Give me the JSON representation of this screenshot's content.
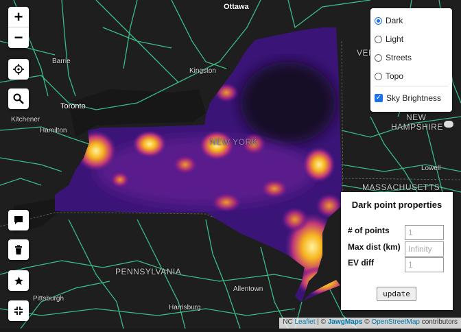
{
  "cities": {
    "ottawa": "Ottawa",
    "barrie": "Barrie",
    "kingston": "Kingston",
    "toronto": "Toronto",
    "kitchener": "Kitchener",
    "hamilton": "Hamilton",
    "lowell": "Lowell",
    "pittsburgh": "Pittsburgh",
    "harrisburg": "Harrisburg",
    "allentown": "Allentown",
    "new_york": "NEW YORK"
  },
  "regions": {
    "ver": "VER",
    "new_hampshire_1": "NEW",
    "new_hampshire_2": "HAMPSHIRE",
    "massachusetts": "MASSACHUSETTS",
    "pennsylvania": "PENNSYLVANIA"
  },
  "zoom": {
    "in": "+",
    "out": "−"
  },
  "icons": [
    "locate-icon",
    "search-icon",
    "comment-icon",
    "trash-icon",
    "star-icon",
    "collapse-icon"
  ],
  "layers": {
    "base": [
      {
        "label": "Dark",
        "selected": true
      },
      {
        "label": "Light",
        "selected": false
      },
      {
        "label": "Streets",
        "selected": false
      },
      {
        "label": "Topo",
        "selected": false
      }
    ],
    "overlay": {
      "label": "Sky Brightness",
      "checked": true
    }
  },
  "panel": {
    "title": "Dark point properties",
    "fields": [
      {
        "label": "# of points",
        "placeholder": "1"
      },
      {
        "label": "Max dist (km)",
        "placeholder": "Infinity"
      },
      {
        "label": "EV diff",
        "placeholder": "1"
      }
    ],
    "button": "update"
  },
  "attribution": {
    "prefix": "NC",
    "leaflet": "Leaflet",
    "sep1": " | © ",
    "jawg": "JawgMaps",
    "sep2": " © ",
    "osm": "OpenStreetMap",
    "suffix": " contributors"
  },
  "colors": {
    "map_bg": "#1e1e1e",
    "roads": "#3fd99a",
    "glow_low": "#2a0f5e",
    "glow_mid": "#7a1fa2",
    "glow_high": "#f7b51e",
    "accent": "#1a73e8"
  }
}
